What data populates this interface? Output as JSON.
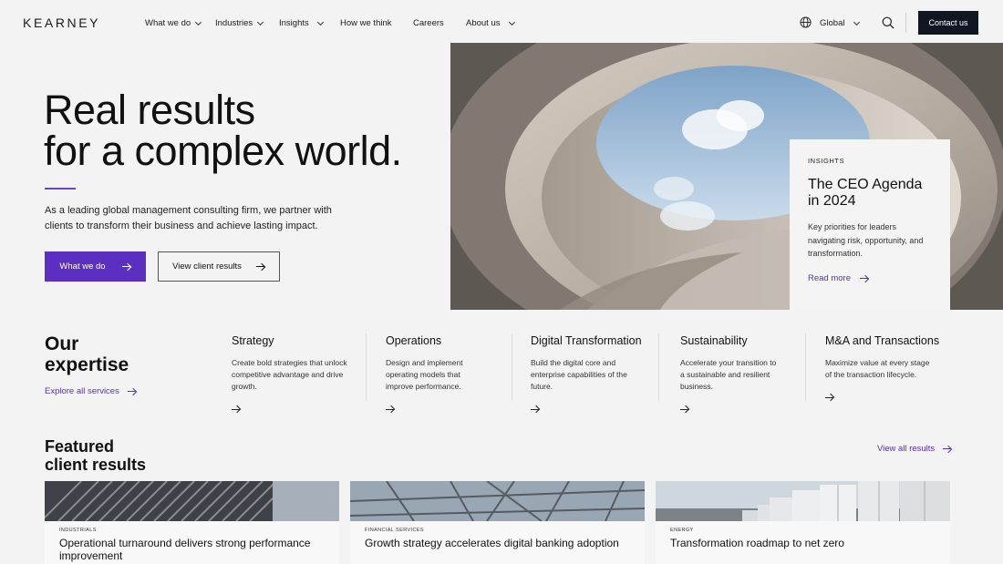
{
  "nav": {
    "logo": "KEARNEY",
    "items": [
      {
        "label": "What we do",
        "has_dropdown": true
      },
      {
        "label": "Industries",
        "has_dropdown": true
      },
      {
        "label": "Insights",
        "has_dropdown": true
      },
      {
        "label": "How we think",
        "has_dropdown": false
      },
      {
        "label": "Careers",
        "has_dropdown": false
      },
      {
        "label": "About us",
        "has_dropdown": true
      }
    ],
    "region_label": "Global",
    "contact_label": "Contact us"
  },
  "hero": {
    "title_line1": "Real results",
    "title_line2": "for a complex world.",
    "description": "As a leading global management consulting firm, we partner with clients to transform their business and achieve lasting impact.",
    "primary_cta": "What we do",
    "secondary_cta": "View client results"
  },
  "insight_card": {
    "eyebrow": "INSIGHTS",
    "title": "The CEO Agenda in 2024",
    "description": "Key priorities for leaders navigating risk, opportunity, and transformation.",
    "link": "Read more"
  },
  "expertise": {
    "title_line1": "Our",
    "title_line2": "expertise",
    "link": "Explore all services",
    "items": [
      {
        "title": "Strategy",
        "description": "Create bold strategies that unlock competitive advantage and drive growth."
      },
      {
        "title": "Operations",
        "description": "Design and implement operating models that improve performance."
      },
      {
        "title": "Digital Transformation",
        "description": "Build the digital core and enterprise capabilities of the future."
      },
      {
        "title": "Sustainability",
        "description": "Accelerate your transition to a sustainable and resilient business."
      },
      {
        "title": "M&A and Transactions",
        "description": "Maximize value at every stage of the transaction lifecycle."
      }
    ]
  },
  "featured": {
    "title_line1": "Featured",
    "title_line2": "client results",
    "link": "View all results",
    "cards": [
      {
        "eyebrow": "INDUSTRIALS",
        "title": "Operational turnaround delivers strong performance improvement"
      },
      {
        "eyebrow": "FINANCIAL SERVICES",
        "title": "Growth strategy accelerates digital banking adoption"
      },
      {
        "eyebrow": "ENERGY",
        "title": "Transformation roadmap to net zero"
      }
    ]
  },
  "colors": {
    "accent": "#5a2fc2",
    "dark": "#111622",
    "background": "#f4f3f3"
  }
}
